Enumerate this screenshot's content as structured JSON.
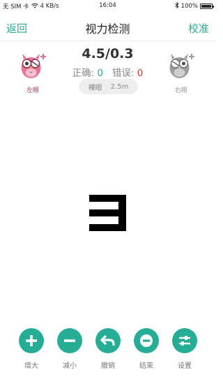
{
  "status": {
    "carrier": "无 SIM 卡",
    "speed": "4 KB/s",
    "time": "16:04",
    "battery": "100%"
  },
  "nav": {
    "back": "返回",
    "title": "视力检测",
    "calibrate": "校准"
  },
  "eyes": {
    "left": "左眼",
    "right": "右眼"
  },
  "result": {
    "score": "4.5/0.3",
    "correct_label": "正确:",
    "correct_count": "0",
    "wrong_label": "错误:",
    "wrong_count": "0",
    "mode": "裸眼",
    "distance": "2.5m"
  },
  "toolbar": {
    "zoom_in": "增大",
    "zoom_out": "减小",
    "undo": "撤销",
    "finish": "结束",
    "settings": "设置"
  },
  "colors": {
    "accent": "#26ad95",
    "correct": "#26ad95",
    "wrong": "#d33a2c",
    "left_eye": "#e57496",
    "right_eye": "#9e9e9e"
  },
  "optotype": {
    "symbol": "E",
    "direction": "left"
  }
}
